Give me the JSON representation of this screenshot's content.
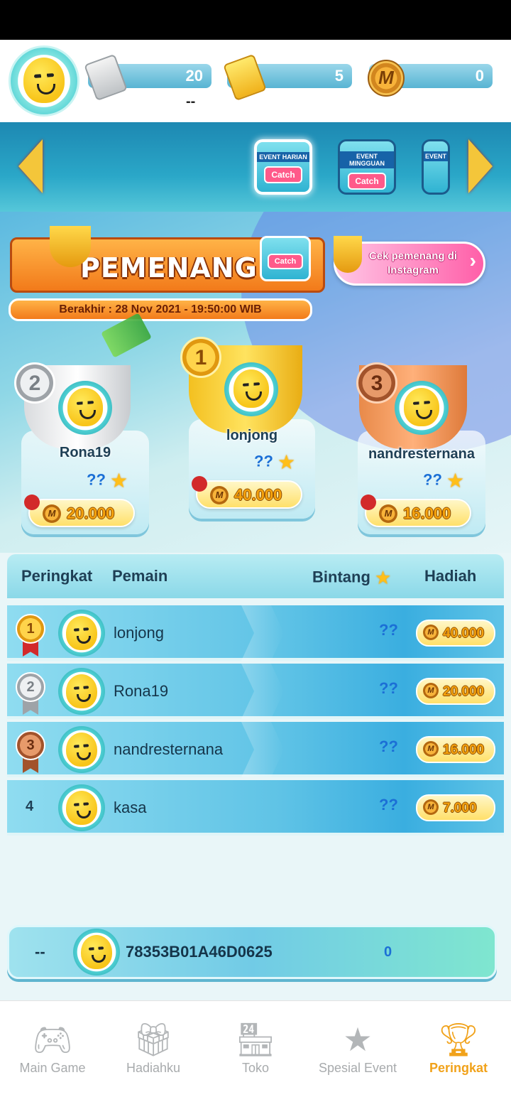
{
  "header": {
    "silver_tickets": "20",
    "gold_tickets": "5",
    "coins": "0",
    "sub_label": "--"
  },
  "events": [
    {
      "label": "EVENT HARIAN",
      "button": "Catch",
      "active": true
    },
    {
      "label": "EVENT MINGGUAN",
      "button": "Catch",
      "active": false
    },
    {
      "label": "EVENT",
      "button": "",
      "active": false
    }
  ],
  "winners_banner": {
    "title": "PEMENANG",
    "badge_label": "EVENT HARIAN",
    "badge_button": "Catch",
    "instagram_text": "Cek pemenang di Instagram",
    "deadline": "Berakhir : 28 Nov 2021 - 19:50:00 WIB"
  },
  "podium": [
    {
      "rank": "1",
      "name": "lonjong",
      "stars": "??",
      "prize": "40.000"
    },
    {
      "rank": "2",
      "name": "Rona19",
      "stars": "??",
      "prize": "20.000"
    },
    {
      "rank": "3",
      "name": "nandresternana",
      "stars": "??",
      "prize": "16.000"
    }
  ],
  "table": {
    "headers": {
      "rank": "Peringkat",
      "player": "Pemain",
      "stars": "Bintang",
      "prize": "Hadiah"
    },
    "rows": [
      {
        "rank": "1",
        "name": "lonjong",
        "stars": "??",
        "prize": "40.000"
      },
      {
        "rank": "2",
        "name": "Rona19",
        "stars": "??",
        "prize": "20.000"
      },
      {
        "rank": "3",
        "name": "nandresternana",
        "stars": "??",
        "prize": "16.000"
      },
      {
        "rank": "4",
        "name": "kasa",
        "stars": "??",
        "prize": "7.000"
      }
    ]
  },
  "my_rank": {
    "rank": "--",
    "id": "78353B01A46D0625",
    "stars": "0"
  },
  "bottom_nav": [
    {
      "label": "Main Game",
      "icon": "gamepad-icon",
      "active": false
    },
    {
      "label": "Hadiahku",
      "icon": "gift-icon",
      "active": false
    },
    {
      "label": "Toko",
      "icon": "store-icon",
      "active": false
    },
    {
      "label": "Spesial Event",
      "icon": "event-box-icon",
      "active": false
    },
    {
      "label": "Peringkat",
      "icon": "trophy-icon",
      "active": true
    }
  ],
  "colors": {
    "accent": "#f1a21a",
    "primary": "#2aa7c8",
    "star_count": "#1b6fd6"
  }
}
